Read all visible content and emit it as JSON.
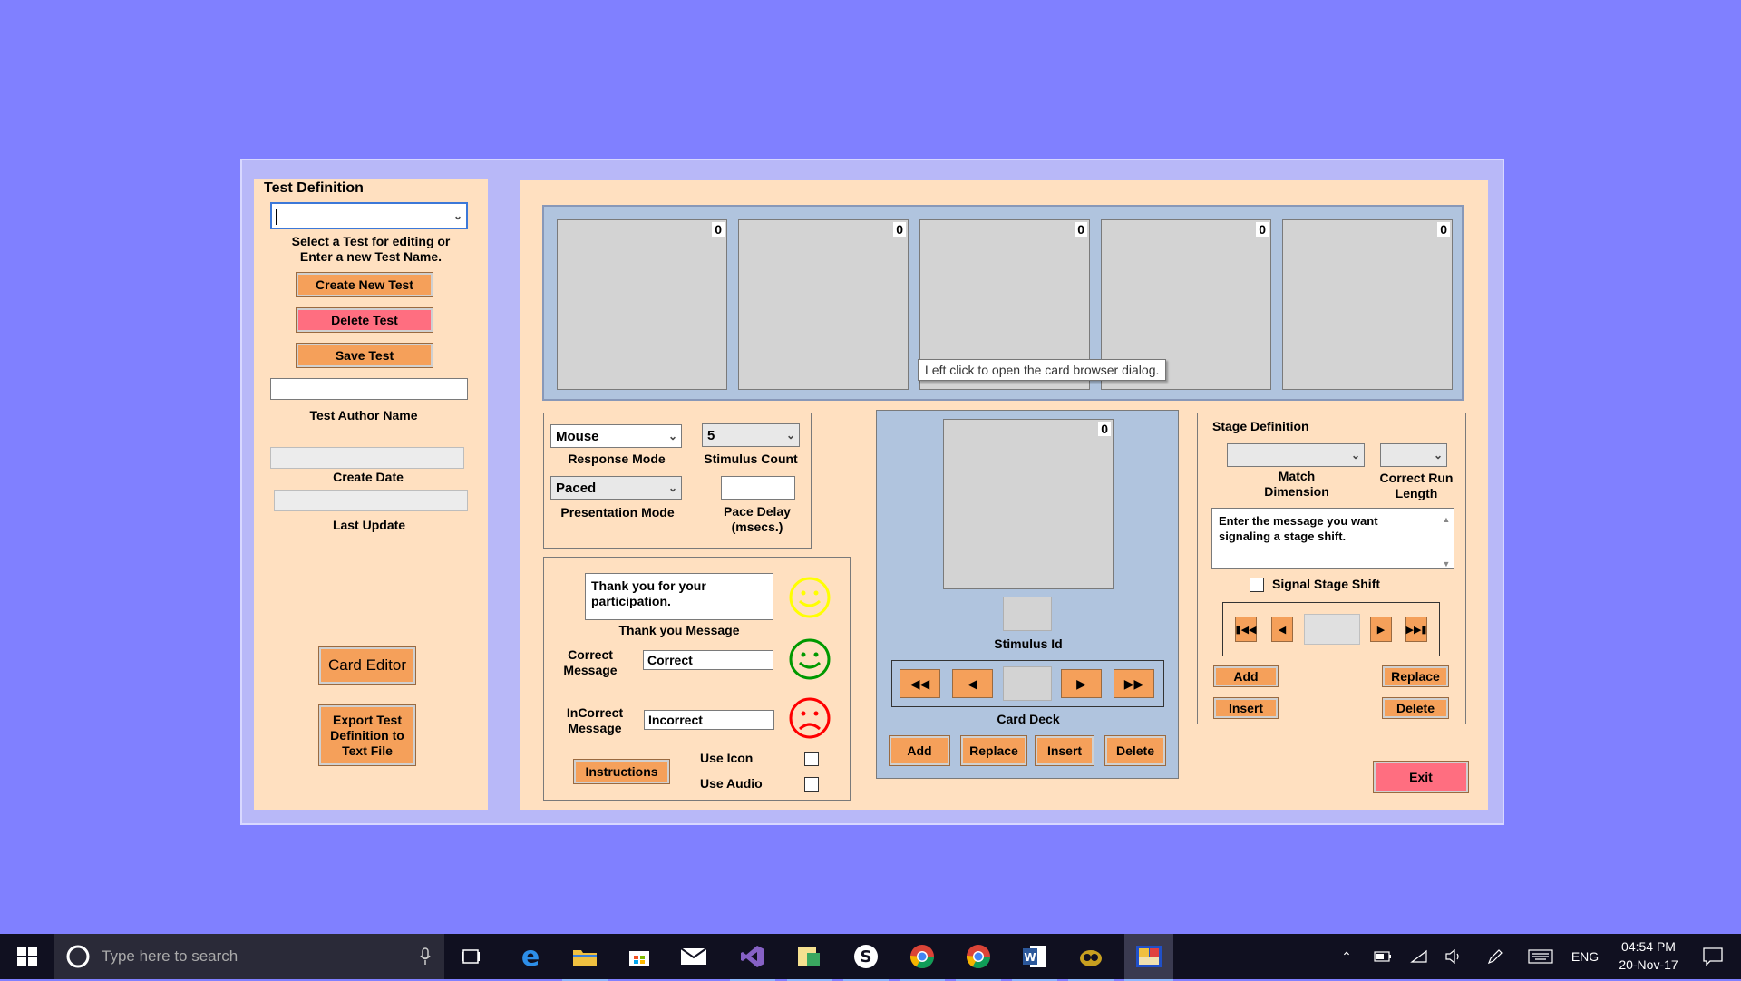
{
  "test_definition": {
    "title": "Test Definition",
    "test_select_value": "",
    "hint_line1": "Select a Test for editing or",
    "hint_line2": "Enter a new Test Name.",
    "create_button": "Create New Test",
    "delete_button": "Delete Test",
    "save_button": "Save Test",
    "author_value": "",
    "author_label": "Test Author Name",
    "create_date_value": "",
    "create_date_label": "Create Date",
    "last_update_value": "",
    "last_update_label": "Last Update",
    "card_editor_button": "Card Editor",
    "export_line1": "Export Test",
    "export_line2": "Definition to",
    "export_line3": "Text File"
  },
  "card_slots": [
    {
      "count": "0"
    },
    {
      "count": "0"
    },
    {
      "count": "0"
    },
    {
      "count": "0"
    },
    {
      "count": "0"
    }
  ],
  "tooltip": "Left click to open the card browser dialog.",
  "settings": {
    "response_mode_value": "Mouse",
    "response_mode_label": "Response Mode",
    "stimulus_count_value": "5",
    "stimulus_count_label": "Stimulus Count",
    "presentation_mode_value": "Paced",
    "presentation_mode_label": "Presentation Mode",
    "pace_delay_value": "",
    "pace_delay_line1": "Pace Delay",
    "pace_delay_line2": "(msecs.)"
  },
  "messages": {
    "thank_you_text": "Thank you for your participation.",
    "thank_you_label": "Thank you Message",
    "correct_label_line1": "Correct",
    "correct_label_line2": "Message",
    "correct_value": "Correct",
    "incorrect_label_line1": "InCorrect",
    "incorrect_label_line2": "Message",
    "incorrect_value": "Incorrect",
    "instructions_button": "Instructions",
    "use_icon_label": "Use Icon",
    "use_audio_label": "Use Audio",
    "colors": {
      "thank_you": "#ffff00",
      "correct": "#009900",
      "incorrect": "#ff0000"
    }
  },
  "card_deck": {
    "stimulus_count": "0",
    "stimulus_id_label": "Stimulus Id",
    "deck_position": "",
    "deck_label": "Card Deck",
    "add": "Add",
    "replace": "Replace",
    "insert": "Insert",
    "delete": "Delete"
  },
  "stage_definition": {
    "title": "Stage Definition",
    "match_dimension_line1": "Match",
    "match_dimension_line2": "Dimension",
    "correct_run_line1": "Correct Run",
    "correct_run_line2": "Length",
    "shift_message": "Enter the message you want signaling a stage shift.",
    "signal_shift_label": "Signal Stage Shift",
    "stage_position": "",
    "add": "Add",
    "replace": "Replace",
    "insert": "Insert",
    "delete": "Delete"
  },
  "exit_button": "Exit",
  "taskbar": {
    "search_placeholder": "Type here to search",
    "language": "ENG",
    "time": "04:54 PM",
    "date": "20-Nov-17",
    "apps": [
      "task-view",
      "edge",
      "file-explorer",
      "store",
      "mail",
      "visual-studio",
      "app-tool",
      "skype",
      "chrome",
      "chrome-alt",
      "word",
      "app-misc",
      "active-app"
    ]
  }
}
